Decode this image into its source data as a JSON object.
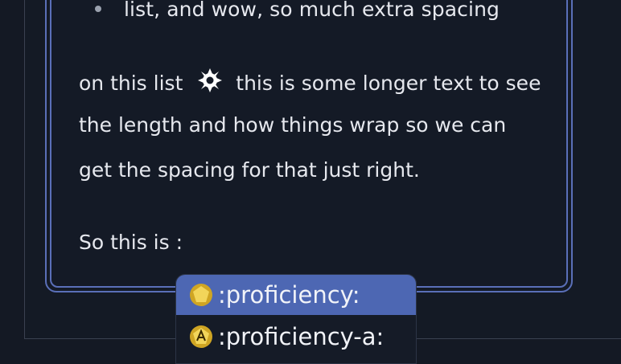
{
  "content": {
    "bullet_text": "list, and wow, so much extra spacing",
    "para_line1_a": "on this list",
    "para_line1_b": "this is some longer text to see",
    "para_line2": "the length and how things wrap so we can",
    "para_line3": "get the spacing for that just right.",
    "input_line": "So this is :"
  },
  "autocomplete": {
    "options": [
      {
        "label": ":proficiency:",
        "icon": "proficiency-icon",
        "selected": true
      },
      {
        "label": ":proficiency-a:",
        "icon": "proficiency-a-icon",
        "selected": false
      }
    ]
  },
  "colors": {
    "background": "#141924",
    "border_accent": "#5a6fb8",
    "selected_option": "#4d67b3",
    "icon_gold": "#e7c23a"
  }
}
